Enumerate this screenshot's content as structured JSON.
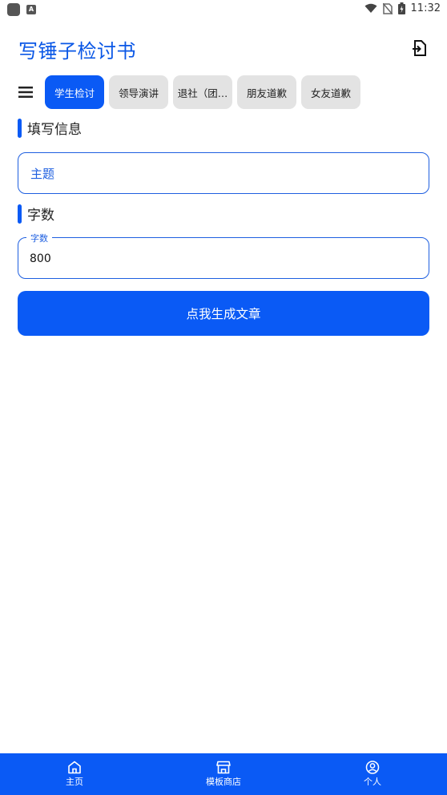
{
  "status_bar": {
    "time": "11:32"
  },
  "app": {
    "title": "写锤子检讨书"
  },
  "tabs": [
    {
      "label": "学生检讨",
      "active": true
    },
    {
      "label": "领导演讲",
      "active": false
    },
    {
      "label": "退社（团…",
      "active": false
    },
    {
      "label": "朋友道歉",
      "active": false
    },
    {
      "label": "女友道歉",
      "active": false
    }
  ],
  "form": {
    "section_info": "填写信息",
    "topic_placeholder": "主题",
    "section_count": "字数",
    "count_label": "字数",
    "count_value": "800",
    "generate_label": "点我生成文章"
  },
  "bottom_nav": [
    {
      "label": "主页",
      "icon": "home-icon"
    },
    {
      "label": "模板商店",
      "icon": "store-icon"
    },
    {
      "label": "个人",
      "icon": "person-icon"
    }
  ],
  "colors": {
    "accent": "#0a5af5",
    "tab_inactive": "#e3e3e3"
  }
}
